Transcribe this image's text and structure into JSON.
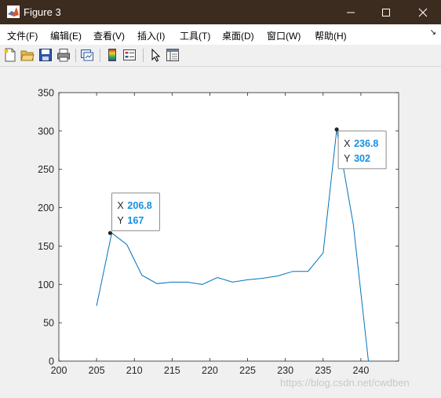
{
  "window": {
    "title": "Figure 3"
  },
  "menu": [
    "文件(F)",
    "编辑(E)",
    "查看(V)",
    "插入(I)",
    "工具(T)",
    "桌面(D)",
    "窗口(W)",
    "帮助(H)"
  ],
  "toolbar_icons": [
    "new-figure-icon",
    "open-file-icon",
    "save-icon",
    "print-icon",
    "link-plot-icon",
    "insert-colorbar-icon",
    "insert-legend-icon",
    "edit-plot-arrow-icon",
    "property-inspector-icon"
  ],
  "chart_data": {
    "type": "line",
    "x": [
      205,
      207,
      209,
      211,
      213,
      215,
      217,
      219,
      221,
      223,
      225,
      227,
      229,
      231,
      233,
      235,
      236.8,
      239,
      241
    ],
    "values": [
      72,
      167,
      152,
      112,
      101,
      103,
      103,
      100,
      109,
      103,
      106,
      108,
      111,
      117,
      117,
      141,
      302,
      178,
      0
    ],
    "xlim": [
      200,
      245
    ],
    "ylim": [
      0,
      350
    ],
    "xticks": [
      200,
      205,
      210,
      215,
      220,
      225,
      230,
      235,
      240
    ],
    "yticks": [
      0,
      50,
      100,
      150,
      200,
      250,
      300,
      350
    ],
    "line_color": "#0072bd",
    "grid": false,
    "datatips": [
      {
        "x_label": "X",
        "x_value": "206.8",
        "y_label": "Y",
        "y_value": "167",
        "x": 206.8,
        "y": 167
      },
      {
        "x_label": "X",
        "x_value": "236.8",
        "y_label": "Y",
        "y_value": "302",
        "x": 236.8,
        "y": 302
      }
    ]
  },
  "watermark": "https://blog.csdn.net/cwdben"
}
